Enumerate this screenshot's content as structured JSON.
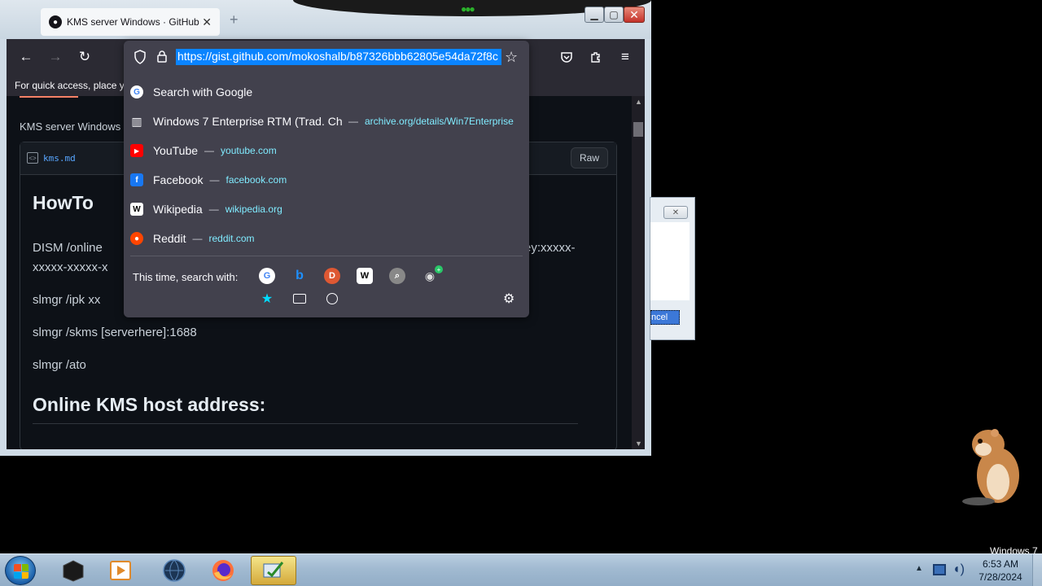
{
  "browser": {
    "tab_title": "KMS server Windows · GitHub",
    "tab_close": "✕",
    "new_tab": "+",
    "bookmarks_bar_text": "For quick access, place yo",
    "url": "https://gist.github.com/mokoshalb/b87326bbb62805e54da72f8c"
  },
  "gist": {
    "title": "KMS server Windows",
    "file_name": "kms.md",
    "raw_label": "Raw",
    "howto": "HowTo",
    "dism_line1": "DISM /online",
    "dism_line2": "xxxxx-xxxxx-x",
    "key_text": "Key:xxxxx-",
    "ipk": "slmgr /ipk xx",
    "skms": "slmgr /skms [serverhere]:1688",
    "ato": "slmgr /ato",
    "online_heading": "Online KMS host address:"
  },
  "urlbar_panel": {
    "suggestions": [
      {
        "icon": "google-search-icon",
        "label": "Search with Google",
        "url": ""
      },
      {
        "icon": "archive-icon",
        "label": "Windows 7 Enterprise RTM (Trad. Chi",
        "url": "archive.org/details/Win7Enterprise"
      },
      {
        "icon": "youtube-icon",
        "label": "YouTube",
        "url": "youtube.com"
      },
      {
        "icon": "facebook-icon",
        "label": "Facebook",
        "url": "facebook.com"
      },
      {
        "icon": "wikipedia-icon",
        "label": "Wikipedia",
        "url": "wikipedia.org"
      },
      {
        "icon": "reddit-icon",
        "label": "Reddit",
        "url": "reddit.com"
      }
    ],
    "dash": "—",
    "search_with_label": "This time, search with:"
  },
  "dialog": {
    "close": "✕",
    "cancel_label": "ncel"
  },
  "desktop": {
    "watermark": "Windows 7"
  },
  "taskbar": {
    "time": "6:53 AM",
    "date": "7/28/2024"
  },
  "colors": {
    "url_highlight": "#0a84ff",
    "panel_bg": "#42414d",
    "url_link": "#80ebff",
    "content_bg": "#0d1117"
  }
}
